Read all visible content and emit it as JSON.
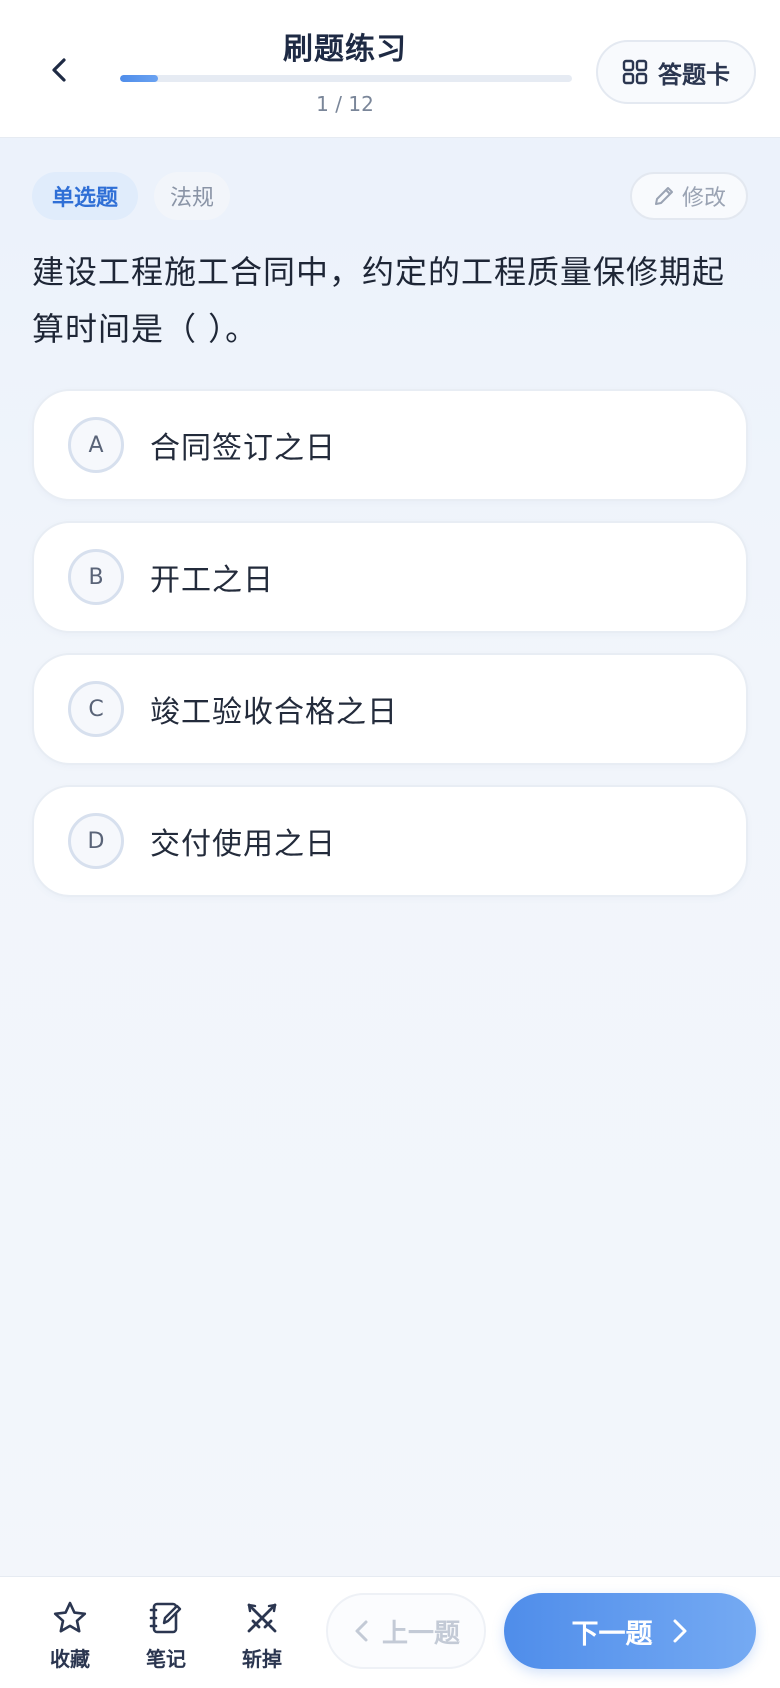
{
  "header": {
    "title": "刷题练习",
    "progress_text": "1 / 12",
    "progress_fraction": 0.083,
    "answer_card_label": "答题卡"
  },
  "question": {
    "type_tag": "单选题",
    "subject_tag": "法规",
    "edit_label": "修改",
    "text": "建设工程施工合同中，约定的工程质量保修期起算时间是（ ）。",
    "options": [
      {
        "letter": "A",
        "text": "合同签订之日"
      },
      {
        "letter": "B",
        "text": "开工之日"
      },
      {
        "letter": "C",
        "text": "竣工验收合格之日"
      },
      {
        "letter": "D",
        "text": "交付使用之日"
      }
    ]
  },
  "bottom_bar": {
    "favorite_label": "收藏",
    "notes_label": "笔记",
    "eliminate_label": "斩掉",
    "prev_label": "上一题",
    "next_label": "下一题"
  },
  "colors": {
    "accent": "#4f8dea",
    "tag_bg": "#e0ecfb",
    "text_dark": "#1e2636"
  }
}
